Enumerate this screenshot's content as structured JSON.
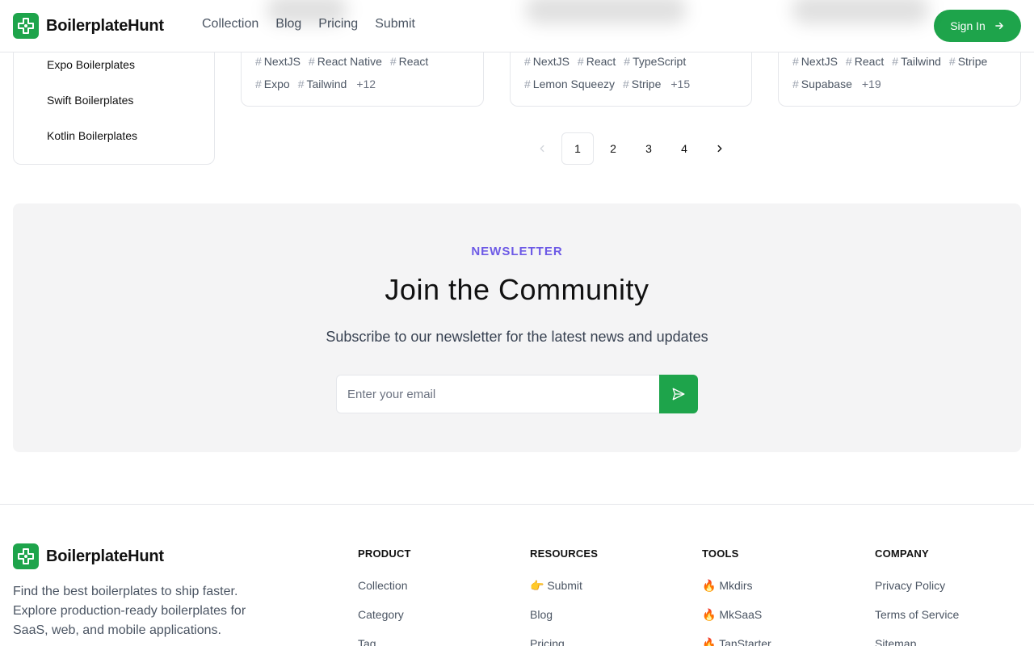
{
  "brand": {
    "name": "BoilerplateHunt",
    "color": "#1ea44b"
  },
  "nav": [
    "Collection",
    "Blog",
    "Pricing",
    "Submit"
  ],
  "header": {
    "signin_label": "Sign In"
  },
  "sidebar": {
    "items": [
      "Expo Boilerplates",
      "Swift Boilerplates",
      "Kotlin Boilerplates"
    ]
  },
  "cards": [
    {
      "row1": [
        "NextJS",
        "React Native",
        "React"
      ],
      "row2": [
        "Expo",
        "Tailwind"
      ],
      "more": "+12"
    },
    {
      "row1": [
        "NextJS",
        "React",
        "TypeScript"
      ],
      "row2": [
        "Lemon Squeezy",
        "Stripe"
      ],
      "more": "+15"
    },
    {
      "row1": [
        "NextJS",
        "React",
        "Tailwind",
        "Stripe"
      ],
      "row2": [
        "Supabase"
      ],
      "more": "+19"
    }
  ],
  "pagination": {
    "pages": [
      "1",
      "2",
      "3",
      "4"
    ],
    "current": "1"
  },
  "newsletter": {
    "label": "NEWSLETTER",
    "title": "Join the Community",
    "subtitle": "Subscribe to our newsletter for the latest news and updates",
    "placeholder": "Enter your email"
  },
  "footer": {
    "description": "Find the best boilerplates to ship faster. Explore production-ready boilerplates for SaaS, web, and mobile applications.",
    "columns": [
      {
        "title": "PRODUCT",
        "links": [
          "Collection",
          "Category",
          "Tag"
        ]
      },
      {
        "title": "RESOURCES",
        "links": [
          "👉 Submit",
          "Blog",
          "Pricing"
        ]
      },
      {
        "title": "TOOLS",
        "links": [
          "🔥 Mkdirs",
          "🔥 MkSaaS",
          "🔥 TanStarter"
        ]
      },
      {
        "title": "COMPANY",
        "links": [
          "Privacy Policy",
          "Terms of Service",
          "Sitemap"
        ]
      }
    ]
  }
}
